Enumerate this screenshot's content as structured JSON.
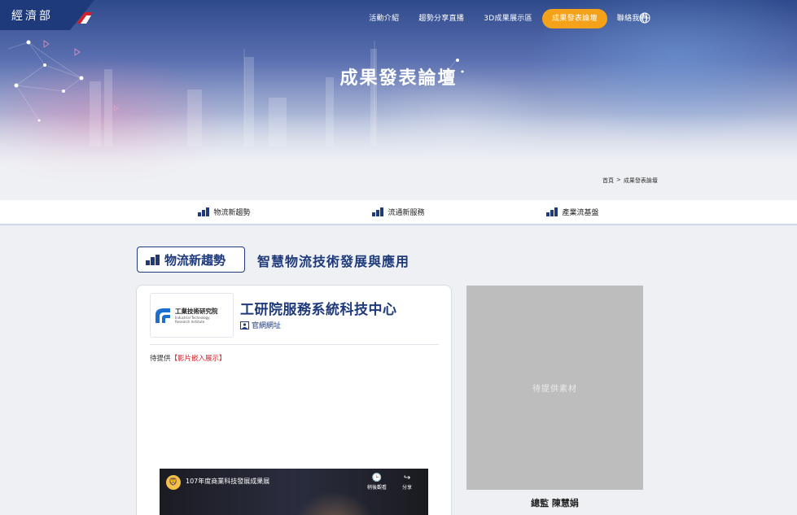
{
  "header": {
    "logo_text": "經濟部",
    "nav": [
      {
        "label": "活動介紹",
        "active": false
      },
      {
        "label": "趨勢分享直播",
        "active": false
      },
      {
        "label": "3D成果展示區",
        "active": false
      },
      {
        "label": "成果發表論壇",
        "active": true
      },
      {
        "label": "聯絡我們",
        "active": false
      }
    ],
    "globe_icon": "globe-icon"
  },
  "hero": {
    "title": "成果發表論壇"
  },
  "breadcrumb": {
    "home": "首頁",
    "separator": ">",
    "current": "成果發表論壇"
  },
  "tabs": [
    {
      "label": "物流新趨勢",
      "icon": "bar-chart-icon"
    },
    {
      "label": "流通新服務",
      "icon": "bar-chart-icon"
    },
    {
      "label": "產業流基盤",
      "icon": "bar-chart-icon"
    }
  ],
  "section": {
    "badge": "物流新趨勢",
    "title": "智慧物流技術發展與應用"
  },
  "card": {
    "org_logo": {
      "line1": "工業技術研究院",
      "line2": "Industrial Technology",
      "line3": "Research Institute"
    },
    "org_name": "工研院服務系統科技中心",
    "website_label": "官網網址",
    "pending_prefix": "待提供",
    "pending_red": "【影片嵌入展示】",
    "video": {
      "title": "107年度商業科技發展成果展",
      "watch_later": "稍後觀看",
      "share": "分享"
    }
  },
  "side": {
    "placeholder": "待提供素材",
    "caption": "總監 陳慧娟"
  },
  "colors": {
    "brand": "#1e3a7b",
    "accent": "#f4a21a",
    "highlight_red": "#d3212b"
  }
}
